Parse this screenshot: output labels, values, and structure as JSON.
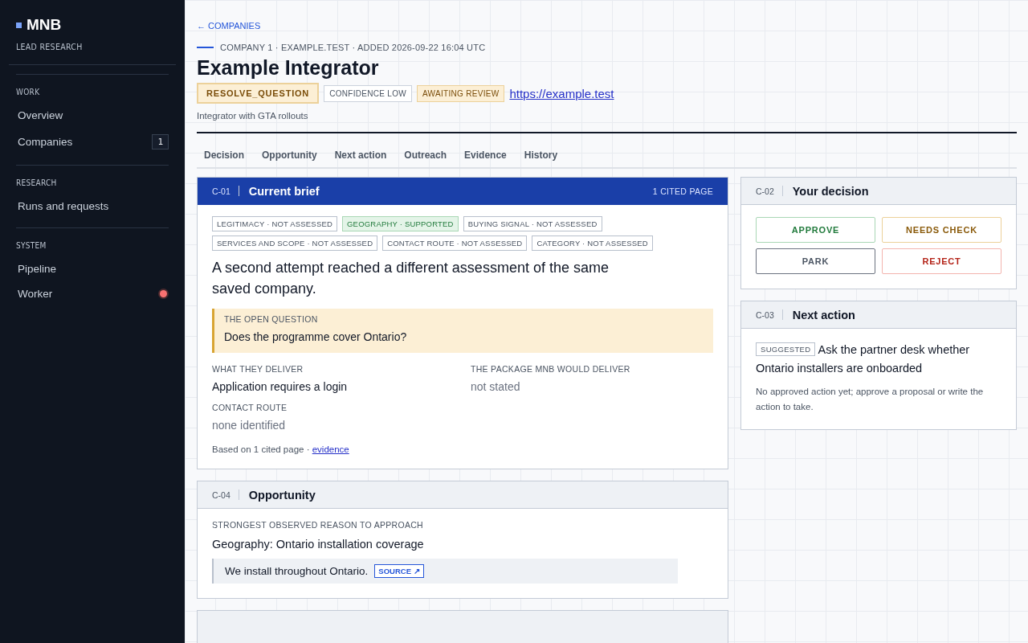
{
  "sidebar": {
    "brand": "MNB",
    "subtitle": "LEAD RESEARCH",
    "sections": [
      {
        "heading": "WORK",
        "items": [
          {
            "label": "Overview"
          },
          {
            "label": "Companies",
            "count": "1"
          }
        ]
      },
      {
        "heading": "RESEARCH",
        "items": [
          {
            "label": "Runs and requests"
          }
        ]
      },
      {
        "heading": "SYSTEM",
        "items": [
          {
            "label": "Pipeline"
          },
          {
            "label": "Worker",
            "color": "#f87171"
          }
        ]
      }
    ]
  },
  "back_link": "← COMPANIES",
  "meta": "COMPANY 1 · EXAMPLE.TEST · ADDED 2026-09-22 16:04 UTC",
  "title": "Example Integrator",
  "badges": [
    {
      "label": "RESOLVE_QUESTION",
      "kind": "primary"
    },
    {
      "label": "CONFIDENCE LOW",
      "kind": "neutral"
    },
    {
      "label": "AWAITING REVIEW",
      "kind": "warning"
    }
  ],
  "url": "https://example.test",
  "summary": "Integrator with GTA rollouts",
  "tabs": [
    {
      "label": "Decision"
    },
    {
      "label": "Opportunity"
    },
    {
      "label": "Next action"
    },
    {
      "label": "Outreach"
    },
    {
      "label": "Evidence"
    },
    {
      "label": "History"
    }
  ],
  "brief": {
    "code": "C-01",
    "title": "Current brief",
    "cited": "1 CITED PAGE",
    "tags": [
      {
        "label": "LEGITIMACY · NOT ASSESSED",
        "kind": "neutral"
      },
      {
        "label": "GEOGRAPHY · SUPPORTED",
        "kind": "supported"
      },
      {
        "label": "BUYING SIGNAL · NOT ASSESSED",
        "kind": "neutral"
      },
      {
        "label": "SERVICES AND SCOPE · NOT ASSESSED",
        "kind": "neutral"
      },
      {
        "label": "CONTACT ROUTE · NOT ASSESSED",
        "kind": "neutral"
      },
      {
        "label": "CATEGORY · NOT ASSESSED",
        "kind": "neutral"
      }
    ],
    "statement": "A second attempt reached a different assessment of the same saved company.",
    "question_label": "THE OPEN QUESTION",
    "question": "Does the programme cover Ontario?",
    "fields": [
      {
        "label": "WHAT THEY DELIVER",
        "value": "Application requires a login",
        "known": true
      },
      {
        "label": "THE PACKAGE MNB WOULD DELIVER",
        "value": "not stated",
        "known": false
      },
      {
        "label": "CONTACT ROUTE",
        "value": "none identified",
        "known": false
      }
    ],
    "footer": "Based on 1 cited page ·",
    "footer_link": "evidence"
  },
  "decision": {
    "code": "C-02",
    "title": "Your decision",
    "buttons": [
      {
        "label": "APPROVE",
        "kind": "approve"
      },
      {
        "label": "NEEDS CHECK",
        "kind": "check"
      },
      {
        "label": "PARK",
        "kind": "park"
      },
      {
        "label": "REJECT",
        "kind": "reject"
      }
    ]
  },
  "next_action": {
    "code": "C-03",
    "title": "Next action",
    "tag": "SUGGESTED",
    "text": "Ask the partner desk whether Ontario installers are onboarded",
    "note": "No approved action yet; approve a proposal or write the action to take."
  },
  "opportunity": {
    "code": "C-04",
    "title": "Opportunity",
    "label": "STRONGEST OBSERVED REASON TO APPROACH",
    "reason": "Geography: Ontario installation coverage",
    "quote": "We install throughout Ontario.",
    "source": "SOURCE ↗"
  }
}
